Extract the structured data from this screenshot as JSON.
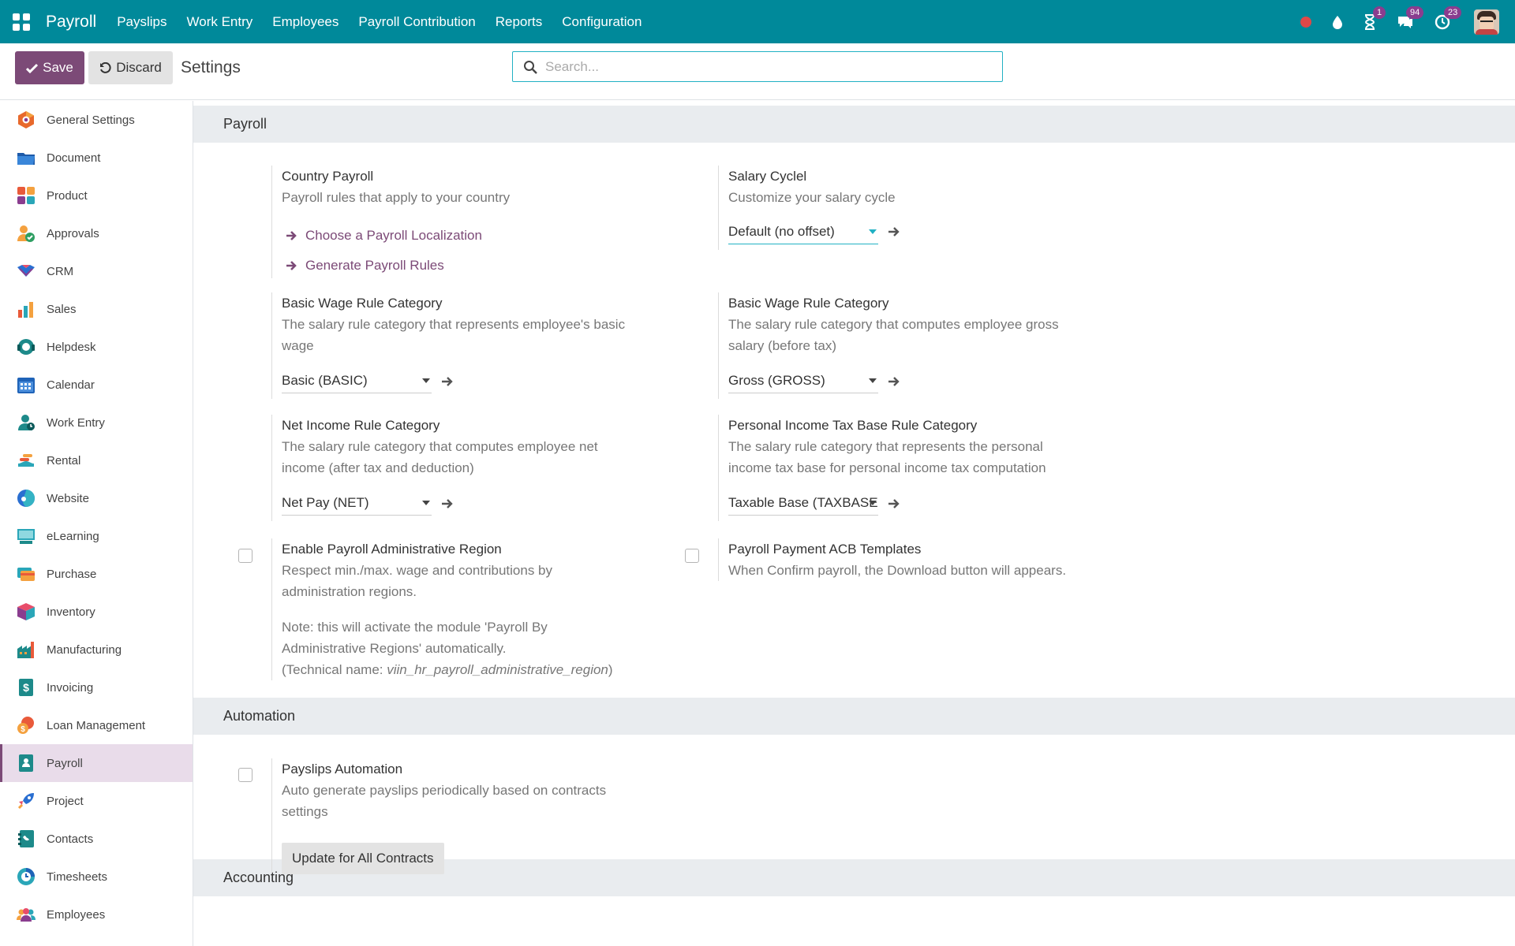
{
  "navbar": {
    "brand": "Payroll",
    "menus": [
      "Payslips",
      "Work Entry",
      "Employees",
      "Payroll Contribution",
      "Reports",
      "Configuration"
    ],
    "badges": {
      "activity": "1",
      "messages": "94",
      "updates": "23"
    }
  },
  "control_panel": {
    "save_label": "Save",
    "discard_label": "Discard",
    "title": "Settings",
    "search_placeholder": "Search..."
  },
  "sidebar": {
    "items": [
      {
        "label": "General Settings",
        "icon": "general-settings-icon"
      },
      {
        "label": "Document",
        "icon": "document-icon"
      },
      {
        "label": "Product",
        "icon": "product-icon"
      },
      {
        "label": "Approvals",
        "icon": "approvals-icon"
      },
      {
        "label": "CRM",
        "icon": "crm-icon"
      },
      {
        "label": "Sales",
        "icon": "sales-icon"
      },
      {
        "label": "Helpdesk",
        "icon": "helpdesk-icon"
      },
      {
        "label": "Calendar",
        "icon": "calendar-icon"
      },
      {
        "label": "Work Entry",
        "icon": "work-entry-icon"
      },
      {
        "label": "Rental",
        "icon": "rental-icon"
      },
      {
        "label": "Website",
        "icon": "website-icon"
      },
      {
        "label": "eLearning",
        "icon": "elearning-icon"
      },
      {
        "label": "Purchase",
        "icon": "purchase-icon"
      },
      {
        "label": "Inventory",
        "icon": "inventory-icon"
      },
      {
        "label": "Manufacturing",
        "icon": "manufacturing-icon"
      },
      {
        "label": "Invoicing",
        "icon": "invoicing-icon"
      },
      {
        "label": "Loan Management",
        "icon": "loan-management-icon"
      },
      {
        "label": "Payroll",
        "icon": "payroll-icon",
        "active": true
      },
      {
        "label": "Project",
        "icon": "project-icon"
      },
      {
        "label": "Contacts",
        "icon": "contacts-icon"
      },
      {
        "label": "Timesheets",
        "icon": "timesheets-icon"
      },
      {
        "label": "Employees",
        "icon": "employees-icon"
      }
    ]
  },
  "sections": {
    "payroll": "Payroll",
    "automation": "Automation",
    "accounting": "Accounting"
  },
  "settings": {
    "country_payroll": {
      "title": "Country Payroll",
      "desc": "Payroll rules that apply to your country",
      "link1": "Choose a Payroll Localization",
      "link2": "Generate Payroll Rules"
    },
    "salary_cycle": {
      "title": "Salary Cyclel",
      "desc": "Customize your salary cycle",
      "value": "Default (no offset)"
    },
    "basic_wage": {
      "title": "Basic Wage Rule Category",
      "desc1": "The salary rule category that represents employee's basic",
      "desc2": "wage",
      "value": "Basic (BASIC)"
    },
    "gross_wage": {
      "title": "Basic Wage Rule Category",
      "desc1": "The salary rule category that computes employee gross",
      "desc2": "salary (before tax)",
      "value": "Gross (GROSS)"
    },
    "net_income": {
      "title": "Net Income Rule Category",
      "desc1": "The salary rule category that computes employee net",
      "desc2": "income (after tax and deduction)",
      "value": "Net Pay (NET)"
    },
    "pit_base": {
      "title": "Personal Income Tax Base Rule Category",
      "desc1": "The salary rule category that represents the personal",
      "desc2": "income tax base for personal income tax computation",
      "value": "Taxable Base (TAXBASE)"
    },
    "admin_region": {
      "title": "Enable Payroll Administrative Region",
      "desc1": "Respect min./max. wage and contributions by",
      "desc2": "administration regions.",
      "note1": "Note: this will activate the module 'Payroll By",
      "note2": "Administrative Regions' automatically.",
      "tech_prefix": "(Technical name: ",
      "tech_name": "viin_hr_payroll_administrative_region",
      "tech_suffix": ")"
    },
    "acb_templates": {
      "title": "Payroll Payment ACB Templates",
      "desc": "When Confirm payroll, the Download button will appears."
    },
    "payslips_automation": {
      "title": "Payslips Automation",
      "desc1": "Auto generate payslips periodically based on contracts",
      "desc2": "settings",
      "button": "Update for All Contracts"
    }
  },
  "colors": {
    "navbar": "#00899a",
    "primary": "#7c4a77",
    "section_bg": "#e9ecef"
  }
}
